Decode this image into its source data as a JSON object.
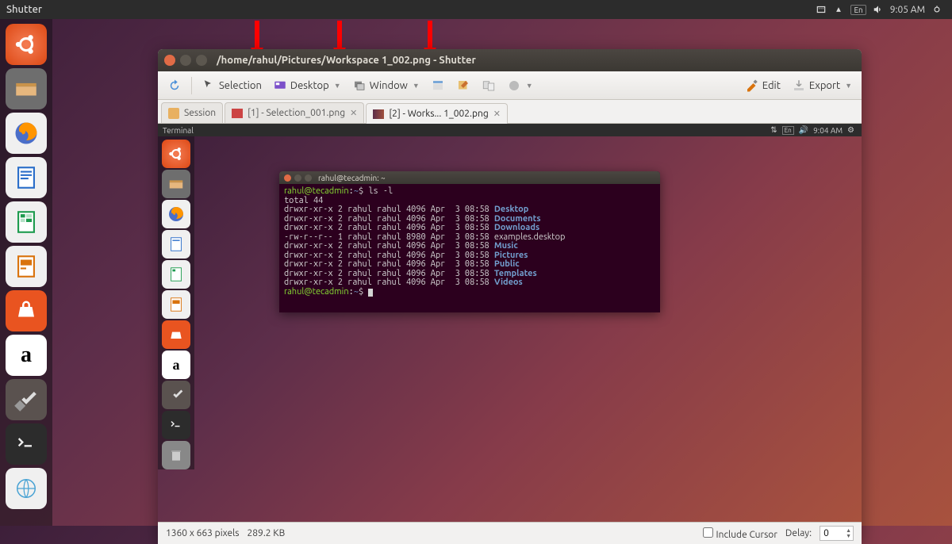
{
  "menubar": {
    "app_name": "Shutter",
    "lang": "En",
    "time": "9:05 AM"
  },
  "launcher": {
    "items": [
      "ubuntu",
      "files",
      "firefox",
      "writer",
      "calc",
      "impress",
      "software",
      "amazon",
      "settings",
      "terminal",
      "screenshot"
    ]
  },
  "shutter": {
    "title": "/home/rahul/Pictures/Workspace 1_002.png - Shutter",
    "toolbar": {
      "redo": "",
      "selection": "Selection",
      "desktop": "Desktop",
      "window": "Window",
      "edit": "Edit",
      "export": "Export"
    },
    "tabs": [
      {
        "label": "Session",
        "closable": false,
        "active": false
      },
      {
        "label": "[1] - Selection_001.png",
        "closable": true,
        "active": false
      },
      {
        "label": "[2] - Works... 1_002.png",
        "closable": true,
        "active": true
      }
    ],
    "statusbar": {
      "dimensions": "1360 x 663 pixels",
      "size": "289.2 KB",
      "include_cursor_label": "Include Cursor",
      "include_cursor": false,
      "delay_label": "Delay:",
      "delay": "0"
    }
  },
  "inner": {
    "menubar_name": "Terminal",
    "lang": "En",
    "time": "9:04 AM"
  },
  "terminal": {
    "title": "rahul@tecadmin: ~",
    "user_host": "rahul@tecadmin",
    "cwd": "~",
    "command": "ls -l",
    "total_line": "total 44",
    "rows": [
      {
        "perm": "drwxr-xr-x 2 rahul rahul 4096 Apr  3 08:58 ",
        "name": "Desktop",
        "type": "dir"
      },
      {
        "perm": "drwxr-xr-x 2 rahul rahul 4096 Apr  3 08:58 ",
        "name": "Documents",
        "type": "dir"
      },
      {
        "perm": "drwxr-xr-x 2 rahul rahul 4096 Apr  3 08:58 ",
        "name": "Downloads",
        "type": "dir"
      },
      {
        "perm": "-rw-r--r-- 1 rahul rahul 8980 Apr  3 08:58 ",
        "name": "examples.desktop",
        "type": "file"
      },
      {
        "perm": "drwxr-xr-x 2 rahul rahul 4096 Apr  3 08:58 ",
        "name": "Music",
        "type": "dir"
      },
      {
        "perm": "drwxr-xr-x 2 rahul rahul 4096 Apr  3 08:58 ",
        "name": "Pictures",
        "type": "dir"
      },
      {
        "perm": "drwxr-xr-x 2 rahul rahul 4096 Apr  3 08:58 ",
        "name": "Public",
        "type": "dir"
      },
      {
        "perm": "drwxr-xr-x 2 rahul rahul 4096 Apr  3 08:58 ",
        "name": "Templates",
        "type": "dir"
      },
      {
        "perm": "drwxr-xr-x 2 rahul rahul 4096 Apr  3 08:58 ",
        "name": "Videos",
        "type": "dir"
      }
    ]
  }
}
